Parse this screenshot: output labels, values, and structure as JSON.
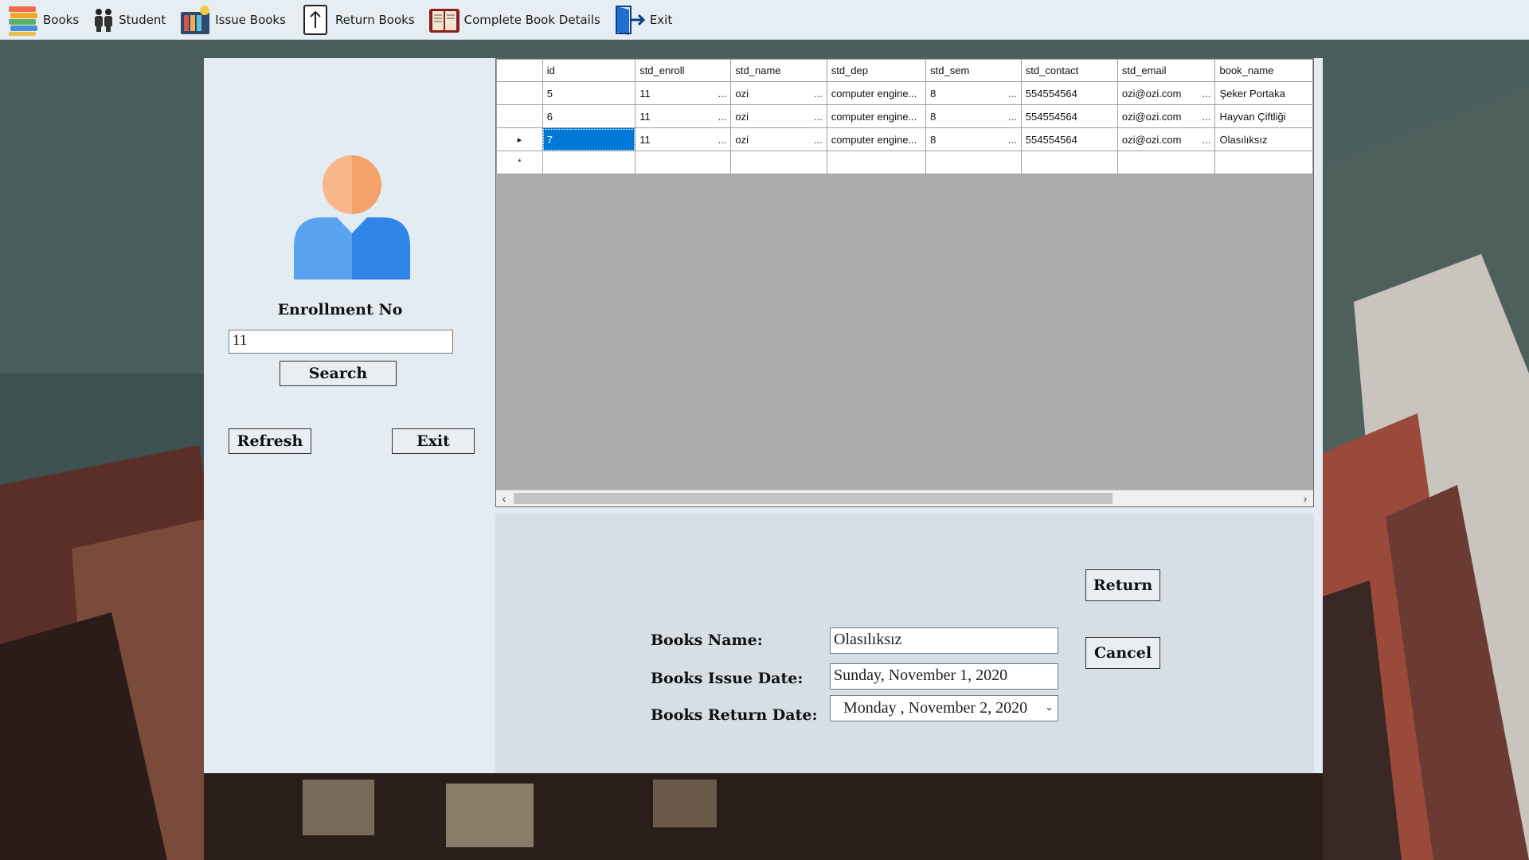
{
  "menu": {
    "items": [
      {
        "label": "Books",
        "icon": "books-stack-icon"
      },
      {
        "label": "Student",
        "icon": "students-icon"
      },
      {
        "label": "Issue Books",
        "icon": "issue-books-icon"
      },
      {
        "label": "Return Books",
        "icon": "return-books-icon"
      },
      {
        "label": "Complete Book Details",
        "icon": "book-details-icon"
      },
      {
        "label": "Exit",
        "icon": "exit-door-icon"
      }
    ]
  },
  "search_panel": {
    "avatar_icon": "user-avatar-icon",
    "enrollment_label": "Enrollment No",
    "enrollment_value": "11",
    "search_button": "Search",
    "refresh_button": "Refresh",
    "exit_button": "Exit"
  },
  "grid": {
    "columns": [
      "id",
      "std_enroll",
      "std_name",
      "std_dep",
      "std_sem",
      "std_contact",
      "std_email",
      "book_name"
    ],
    "rows": [
      [
        "5",
        "11",
        "ozi",
        "computer engine...",
        "8",
        "554554564",
        "ozi@ozi.com",
        "Şeker Portaka"
      ],
      [
        "6",
        "11",
        "ozi",
        "computer engine...",
        "8",
        "554554564",
        "ozi@ozi.com",
        "Hayvan Çiftliği"
      ],
      [
        "7",
        "11",
        "ozi",
        "computer engine...",
        "8",
        "554554564",
        "ozi@ozi.com",
        "Olasılıksız"
      ]
    ],
    "selected_row_marker": "▸",
    "new_row_marker": "*"
  },
  "return_form": {
    "book_name_label": "Books Name:",
    "book_name_value": "Olasılıksız",
    "issue_date_label": "Books Issue Date:",
    "issue_date_value": "Sunday, November 1, 2020",
    "return_date_label": "Books Return Date:",
    "return_date_value": "Monday   , November   2, 2020",
    "return_button": "Return",
    "cancel_button": "Cancel"
  }
}
